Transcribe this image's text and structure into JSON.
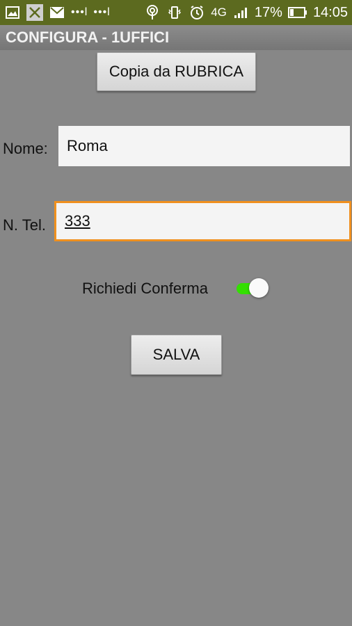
{
  "status_bar": {
    "icons_left": [
      "image-icon",
      "close-box-icon",
      "mail-icon"
    ],
    "dots": [
      "•••l",
      "•••l"
    ],
    "battery_percent": "17%",
    "network": "4G",
    "time": "14:05"
  },
  "app": {
    "title": "CONFIGURA - 1UFFICI"
  },
  "form": {
    "copy_button_label": "Copia da RUBRICA",
    "name_label": "Nome:",
    "name_value": "Roma",
    "phone_label": "N. Tel.",
    "phone_value": "333",
    "confirm_label": "Richiedi Conferma",
    "confirm_toggle_on": true,
    "save_button_label": "SALVA"
  },
  "colors": {
    "status_bar_bg": "#5c6a1f",
    "background": "#878787",
    "focus_border": "#f0901e",
    "switch_on": "#33e000"
  }
}
